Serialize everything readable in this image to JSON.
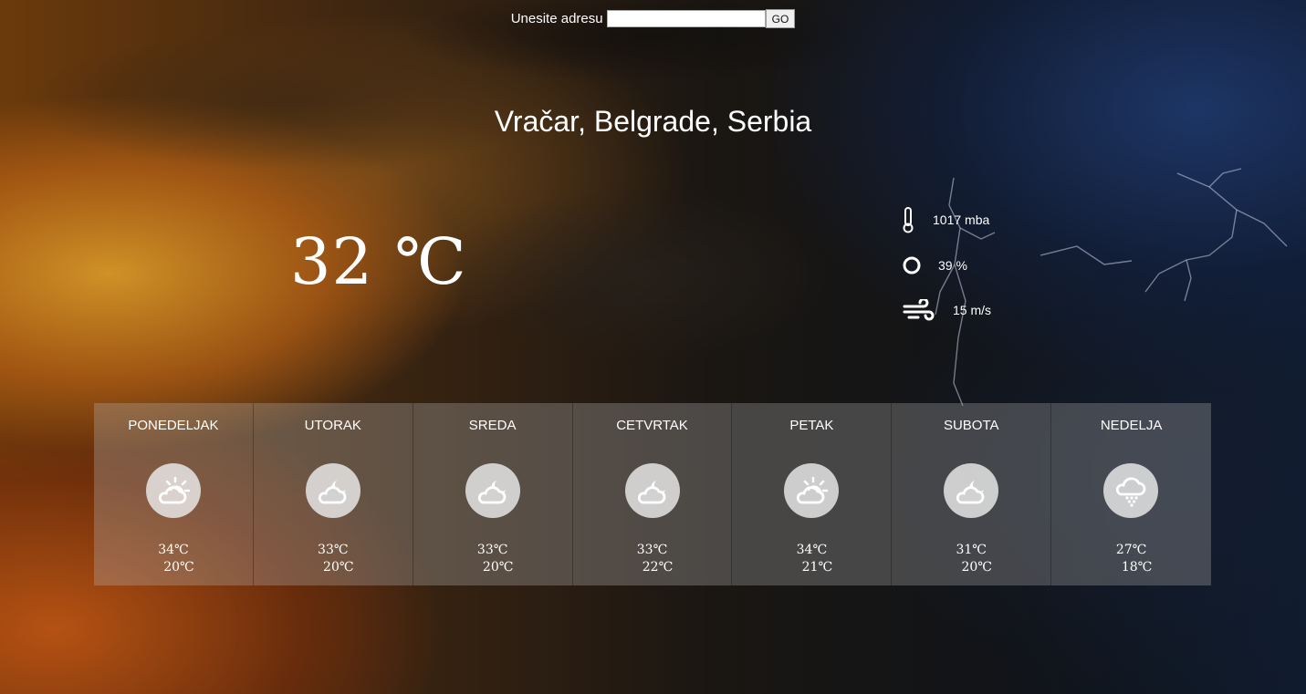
{
  "search": {
    "label": "Unesite adresu",
    "value": "",
    "placeholder": "",
    "go_label": "GO"
  },
  "location": "Vračar, Belgrade, Serbia",
  "current": {
    "temperature": "32 ℃",
    "pressure": "1017 mba",
    "humidity": "39 %",
    "wind": "15 m/s",
    "icons": {
      "pressure": "thermometer-icon",
      "humidity": "humidity-circle-icon",
      "wind": "wind-icon"
    }
  },
  "forecast": [
    {
      "day": "PONEDELJAK",
      "icon": "sun-cloud-icon",
      "max": "34℃",
      "min": "20℃"
    },
    {
      "day": "UTORAK",
      "icon": "moon-cloud-icon",
      "max": "33℃",
      "min": "20℃"
    },
    {
      "day": "SREDA",
      "icon": "moon-cloud-icon",
      "max": "33℃",
      "min": "20℃"
    },
    {
      "day": "CETVRTAK",
      "icon": "moon-cloud-icon",
      "max": "33℃",
      "min": "22℃"
    },
    {
      "day": "PETAK",
      "icon": "sun-cloud-icon",
      "max": "34℃",
      "min": "21℃"
    },
    {
      "day": "SUBOTA",
      "icon": "moon-cloud-icon",
      "max": "31℃",
      "min": "20℃"
    },
    {
      "day": "NEDELJA",
      "icon": "rain-cloud-icon",
      "max": "27℃",
      "min": "18℃"
    }
  ],
  "colors": {
    "icon_circle": "#ebebeb",
    "icon_glyph": "#ffffff",
    "text": "#ffffff"
  }
}
